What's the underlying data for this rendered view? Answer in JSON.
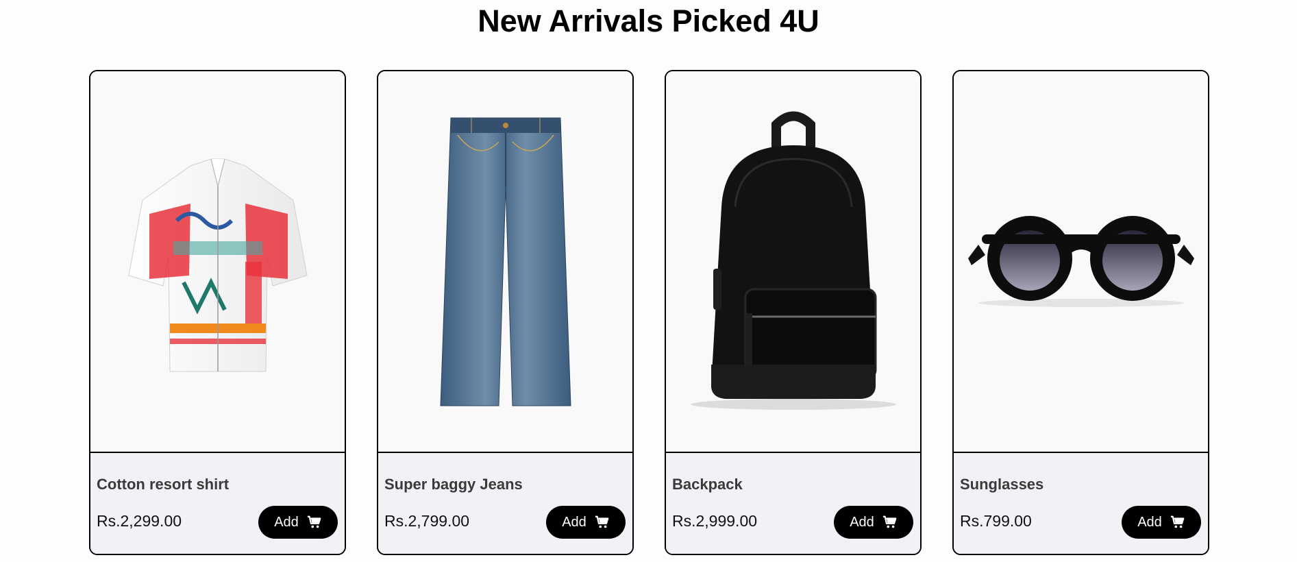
{
  "page": {
    "title": "New Arrivals Picked 4U"
  },
  "products": [
    {
      "name": "Cotton resort shirt",
      "price": "Rs.2,299.00",
      "button_label": "Add",
      "image_icon": "shirt-photo",
      "cart_icon": "cart-icon"
    },
    {
      "name": "Super baggy Jeans",
      "price": "Rs.2,799.00",
      "button_label": "Add",
      "image_icon": "jeans-photo",
      "cart_icon": "cart-icon"
    },
    {
      "name": "Backpack",
      "price": "Rs.2,999.00",
      "button_label": "Add",
      "image_icon": "backpack-photo",
      "cart_icon": "cart-icon"
    },
    {
      "name": "Sunglasses",
      "price": "Rs.799.00",
      "button_label": "Add",
      "image_icon": "sunglasses-photo",
      "cart_icon": "cart-icon"
    }
  ],
  "colors": {
    "button_bg": "#000000",
    "info_bg": "#f1f2f6",
    "card_border": "#000000"
  }
}
